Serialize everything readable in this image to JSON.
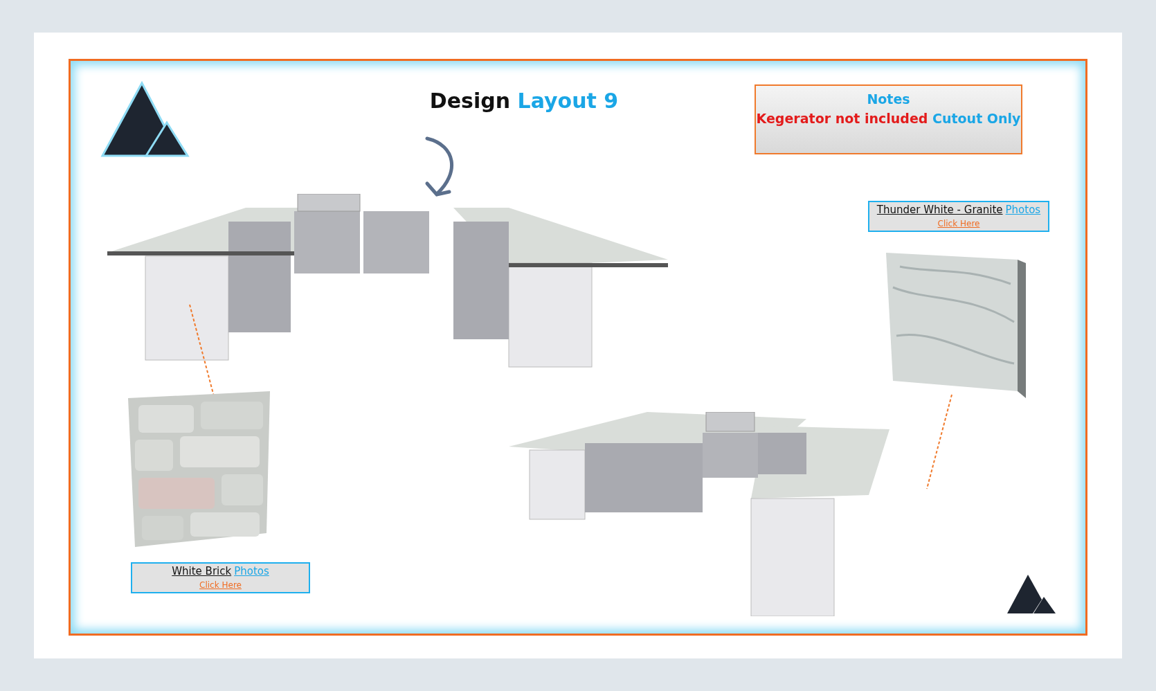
{
  "title": {
    "lead": "Design",
    "highlight": "Layout 9"
  },
  "notes": {
    "heading": "Notes",
    "warning": "Kegerator not included",
    "remark": "Cutout Only"
  },
  "swatches": [
    {
      "kind": "granite",
      "name": "Thunder White - Granite",
      "link": "Photos",
      "action": "Click Here"
    },
    {
      "kind": "brick",
      "name": "White Brick",
      "link": "Photos",
      "action": "Click Here"
    }
  ]
}
